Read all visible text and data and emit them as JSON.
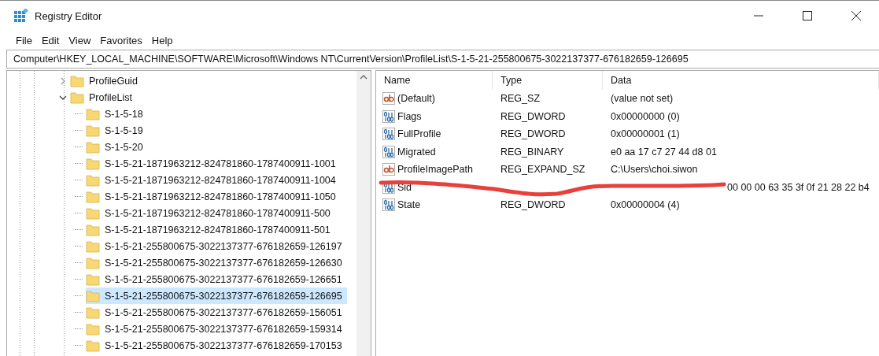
{
  "window": {
    "title": "Registry Editor"
  },
  "menu": [
    "File",
    "Edit",
    "View",
    "Favorites",
    "Help"
  ],
  "address": "Computer\\HKEY_LOCAL_MACHINE\\SOFTWARE\\Microsoft\\Windows NT\\CurrentVersion\\ProfileList\\S-1-5-21-255800675-3022137377-676182659-126695",
  "tree": [
    {
      "label": "ProfileGuid",
      "expanded": false,
      "selected": false
    },
    {
      "label": "ProfileList",
      "expanded": true,
      "selected": false,
      "children": [
        {
          "label": "S-1-5-18",
          "selected": false
        },
        {
          "label": "S-1-5-19",
          "selected": false
        },
        {
          "label": "S-1-5-20",
          "selected": false
        },
        {
          "label": "S-1-5-21-1871963212-824781860-1787400911-1001",
          "selected": false
        },
        {
          "label": "S-1-5-21-1871963212-824781860-1787400911-1004",
          "selected": false
        },
        {
          "label": "S-1-5-21-1871963212-824781860-1787400911-1050",
          "selected": false
        },
        {
          "label": "S-1-5-21-1871963212-824781860-1787400911-500",
          "selected": false
        },
        {
          "label": "S-1-5-21-1871963212-824781860-1787400911-501",
          "selected": false
        },
        {
          "label": "S-1-5-21-255800675-3022137377-676182659-126197",
          "selected": false
        },
        {
          "label": "S-1-5-21-255800675-3022137377-676182659-126630",
          "selected": false
        },
        {
          "label": "S-1-5-21-255800675-3022137377-676182659-126651",
          "selected": false
        },
        {
          "label": "S-1-5-21-255800675-3022137377-676182659-126695",
          "selected": true
        },
        {
          "label": "S-1-5-21-255800675-3022137377-676182659-156051",
          "selected": false
        },
        {
          "label": "S-1-5-21-255800675-3022137377-676182659-159314",
          "selected": false
        },
        {
          "label": "S-1-5-21-255800675-3022137377-676182659-170153",
          "selected": false
        }
      ]
    }
  ],
  "table": {
    "columns": [
      "Name",
      "Type",
      "Data"
    ],
    "rows": [
      {
        "kind": "string",
        "name": "(Default)",
        "type": "REG_SZ",
        "data": "(value not set)"
      },
      {
        "kind": "binary",
        "name": "Flags",
        "type": "REG_DWORD",
        "data": "0x00000000 (0)"
      },
      {
        "kind": "binary",
        "name": "FullProfile",
        "type": "REG_DWORD",
        "data": "0x00000001 (1)"
      },
      {
        "kind": "binary",
        "name": "Migrated",
        "type": "REG_BINARY",
        "data": "e0 aa 17 c7 27 44 d8 01"
      },
      {
        "kind": "string",
        "name": "ProfileImagePath",
        "type": "REG_EXPAND_SZ",
        "data": "C:\\Users\\choi.siwon"
      },
      {
        "kind": "binary",
        "name": "Sid",
        "obscured": true,
        "data": "00 00 00 63 35 3f 0f 21 28 22 b4"
      },
      {
        "kind": "binary",
        "name": "State",
        "type": "REG_DWORD",
        "data": "0x00000004 (4)"
      }
    ]
  }
}
